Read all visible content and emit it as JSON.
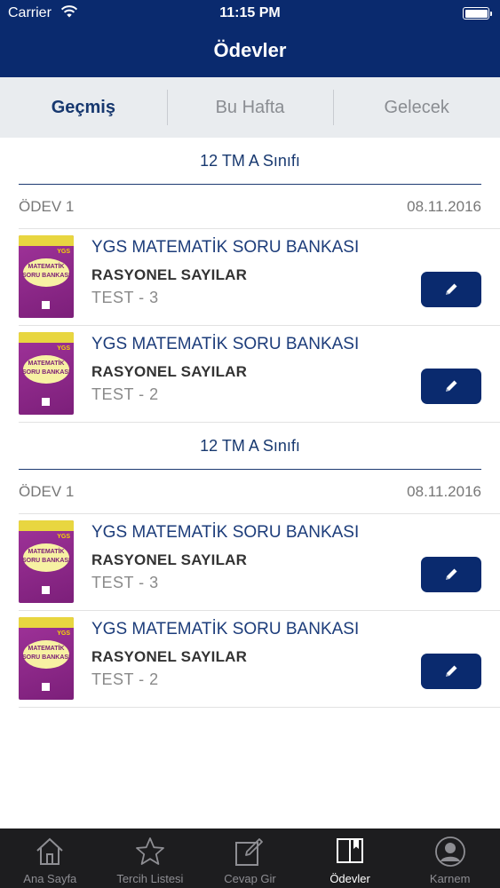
{
  "status_bar": {
    "carrier": "Carrier",
    "time": "11:15 PM"
  },
  "nav": {
    "title": "Ödevler"
  },
  "segments": [
    {
      "label": "Geçmiş",
      "active": true
    },
    {
      "label": "Bu Hafta",
      "active": false
    },
    {
      "label": "Gelecek",
      "active": false
    }
  ],
  "groups": [
    {
      "class_name": "12 TM A Sınıfı",
      "homework": "ÖDEV 1",
      "date": "08.11.2016",
      "items": [
        {
          "book": "YGS MATEMATİK SORU BANKASI",
          "topic": "RASYONEL SAYILAR",
          "test": "TEST - 3"
        },
        {
          "book": "YGS MATEMATİK SORU BANKASI",
          "topic": "RASYONEL SAYILAR",
          "test": "TEST - 2"
        }
      ]
    },
    {
      "class_name": "12 TM A Sınıfı",
      "homework": "ÖDEV 1",
      "date": "08.11.2016",
      "items": [
        {
          "book": "YGS MATEMATİK SORU BANKASI",
          "topic": "RASYONEL SAYILAR",
          "test": "TEST - 3"
        },
        {
          "book": "YGS MATEMATİK SORU BANKASI",
          "topic": "RASYONEL SAYILAR",
          "test": "TEST - 2"
        }
      ]
    }
  ],
  "tabbar": [
    {
      "label": "Ana Sayfa",
      "icon": "home-icon",
      "active": false
    },
    {
      "label": "Tercih Listesi",
      "icon": "star-icon",
      "active": false
    },
    {
      "label": "Cevap Gir",
      "icon": "edit-note-icon",
      "active": false
    },
    {
      "label": "Ödevler",
      "icon": "book-icon",
      "active": true
    },
    {
      "label": "Karnem",
      "icon": "person-icon",
      "active": false
    }
  ],
  "colors": {
    "primary": "#0a2a6e",
    "segment_bg": "#e9ecef",
    "accent_text": "#1c3c7a",
    "cover": "#8e2a8c"
  }
}
